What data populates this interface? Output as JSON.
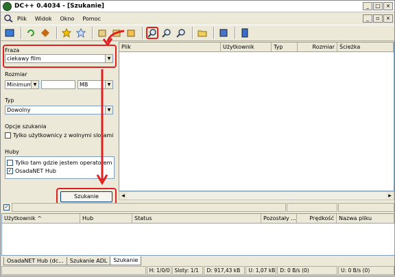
{
  "window": {
    "title": "DC++ 0.4034 - [Szukanie]",
    "controls": [
      "_",
      "□",
      "×"
    ],
    "mdi_controls": [
      "_",
      "▫",
      "×"
    ]
  },
  "menu": [
    "Plik",
    "Widok",
    "Okno",
    "Pomoc"
  ],
  "search": {
    "phrase_label": "Fraza",
    "phrase_value": "ciekawy film",
    "size_label": "Rozmiar",
    "size_mode": "Minimum",
    "size_value": "",
    "size_unit": "MB",
    "type_label": "Typ",
    "type_value": "Dowolny",
    "options_label": "Opcje szukania",
    "free_slots_label": "Tylko użytkownicy z wolnymi slotami",
    "hubs_label": "Huby",
    "hubs": [
      {
        "label": "Tylko tam gdzie jestem operatorem",
        "checked": false
      },
      {
        "label": "OsadaNET Hub",
        "checked": true
      }
    ],
    "button": "Szukanie"
  },
  "results_columns": [
    "Plik",
    "Użytkownik",
    "Typ",
    "Rozmiar",
    "Ścieżka"
  ],
  "queue_columns": [
    "Użytkownik",
    "Hub",
    "Status",
    "Pozostały ...",
    "Prędkość",
    "Nazwa pliku"
  ],
  "queue_sort_indicator": "^",
  "tabs": [
    "OsadaNET Hub (dc...",
    "Szukanie ADL",
    "Szukanie"
  ],
  "statusbar": [
    "H: 1/0/0",
    "Sloty: 1/1",
    "D: 917,43 kB",
    "U: 1,07 kB",
    "D: 0 B/s (0)",
    "U: 0 B/s (0)"
  ],
  "toolbar_icons": [
    "connect-icon",
    "reconnect-icon",
    "follow-icon",
    "favorites-icon",
    "favorite-users-icon",
    "queue-icon",
    "finished-icon",
    "upload-icon",
    "search-icon",
    "adl-search-icon",
    "search-spy-icon",
    "open-filelist-icon",
    "settings-icon",
    "notepad-icon"
  ],
  "colors": {
    "highlight": "#e02020",
    "accent": "#316ac5"
  }
}
